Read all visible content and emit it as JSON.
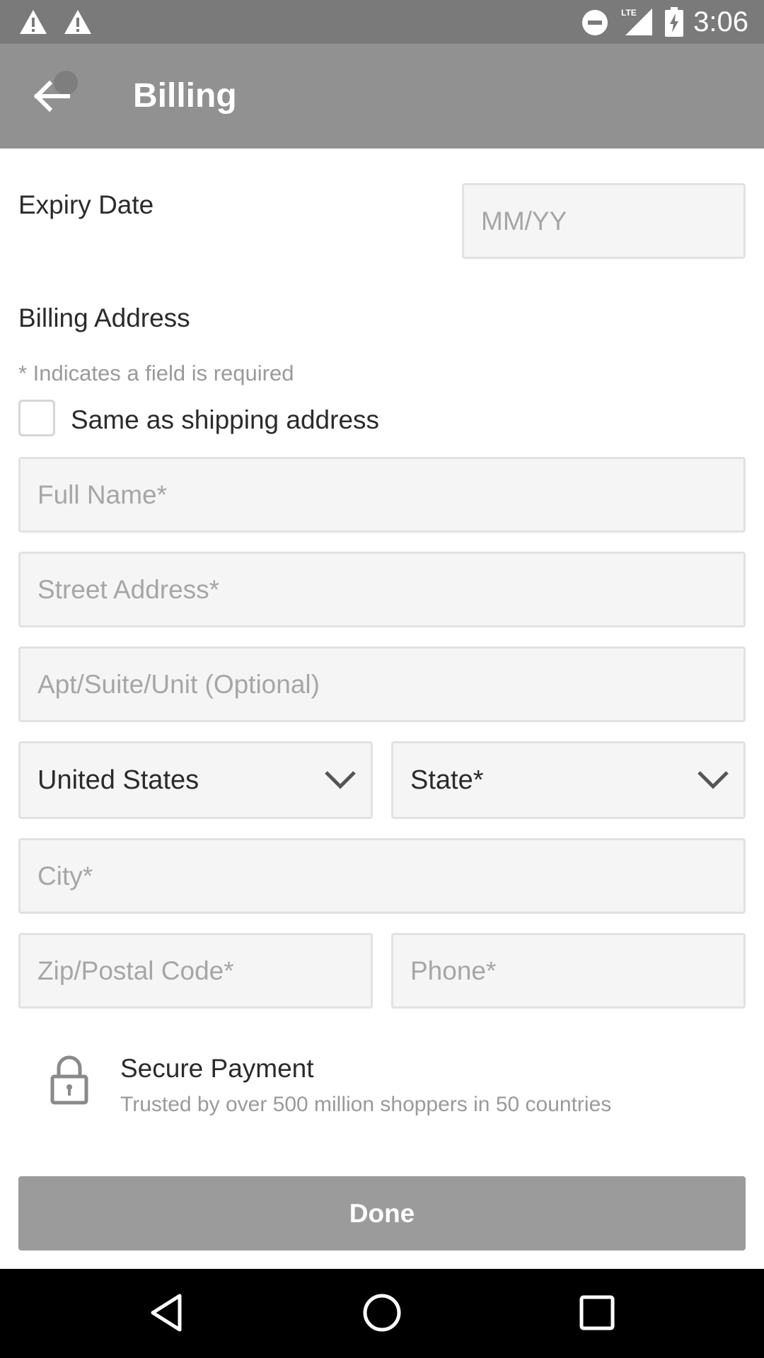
{
  "status_bar": {
    "time": "3:06",
    "left_icons": [
      "warning-icon",
      "warning-icon"
    ],
    "right_icons": [
      "do-not-disturb-icon",
      "lte-signal-icon",
      "battery-charging-icon"
    ],
    "network_label": "LTE"
  },
  "app_bar": {
    "title": "Billing",
    "back_icon": "arrow-back-icon"
  },
  "form": {
    "expiry": {
      "label": "Expiry Date",
      "placeholder": "MM/YY"
    },
    "billing_address": {
      "heading": "Billing Address",
      "required_note": "* Indicates a field is required",
      "same_as_shipping": {
        "label": "Same as shipping address",
        "checked": false
      },
      "full_name_placeholder": "Full Name*",
      "street_placeholder": "Street Address*",
      "apt_placeholder": "Apt/Suite/Unit (Optional)",
      "country": {
        "value": "United States",
        "icon": "chevron-down-icon"
      },
      "state": {
        "value": "State*",
        "icon": "chevron-down-icon"
      },
      "city_placeholder": "City*",
      "zip_placeholder": "Zip/Postal Code*",
      "phone_placeholder": "Phone*"
    }
  },
  "secure": {
    "icon": "lock-icon",
    "title": "Secure Payment",
    "subtitle": "Trusted by over 500 million shoppers in 50 countries"
  },
  "done_button": {
    "label": "Done"
  },
  "nav_bar": {
    "icons": [
      "back-triangle-icon",
      "home-circle-icon",
      "recents-square-icon"
    ]
  },
  "colors": {
    "status_bar": "#7a7a7a",
    "app_bar": "#919191",
    "field_background": "#f5f5f5",
    "field_border": "#e2e2e2",
    "done_button": "#9b9b9b",
    "nav_bar": "#000000"
  }
}
